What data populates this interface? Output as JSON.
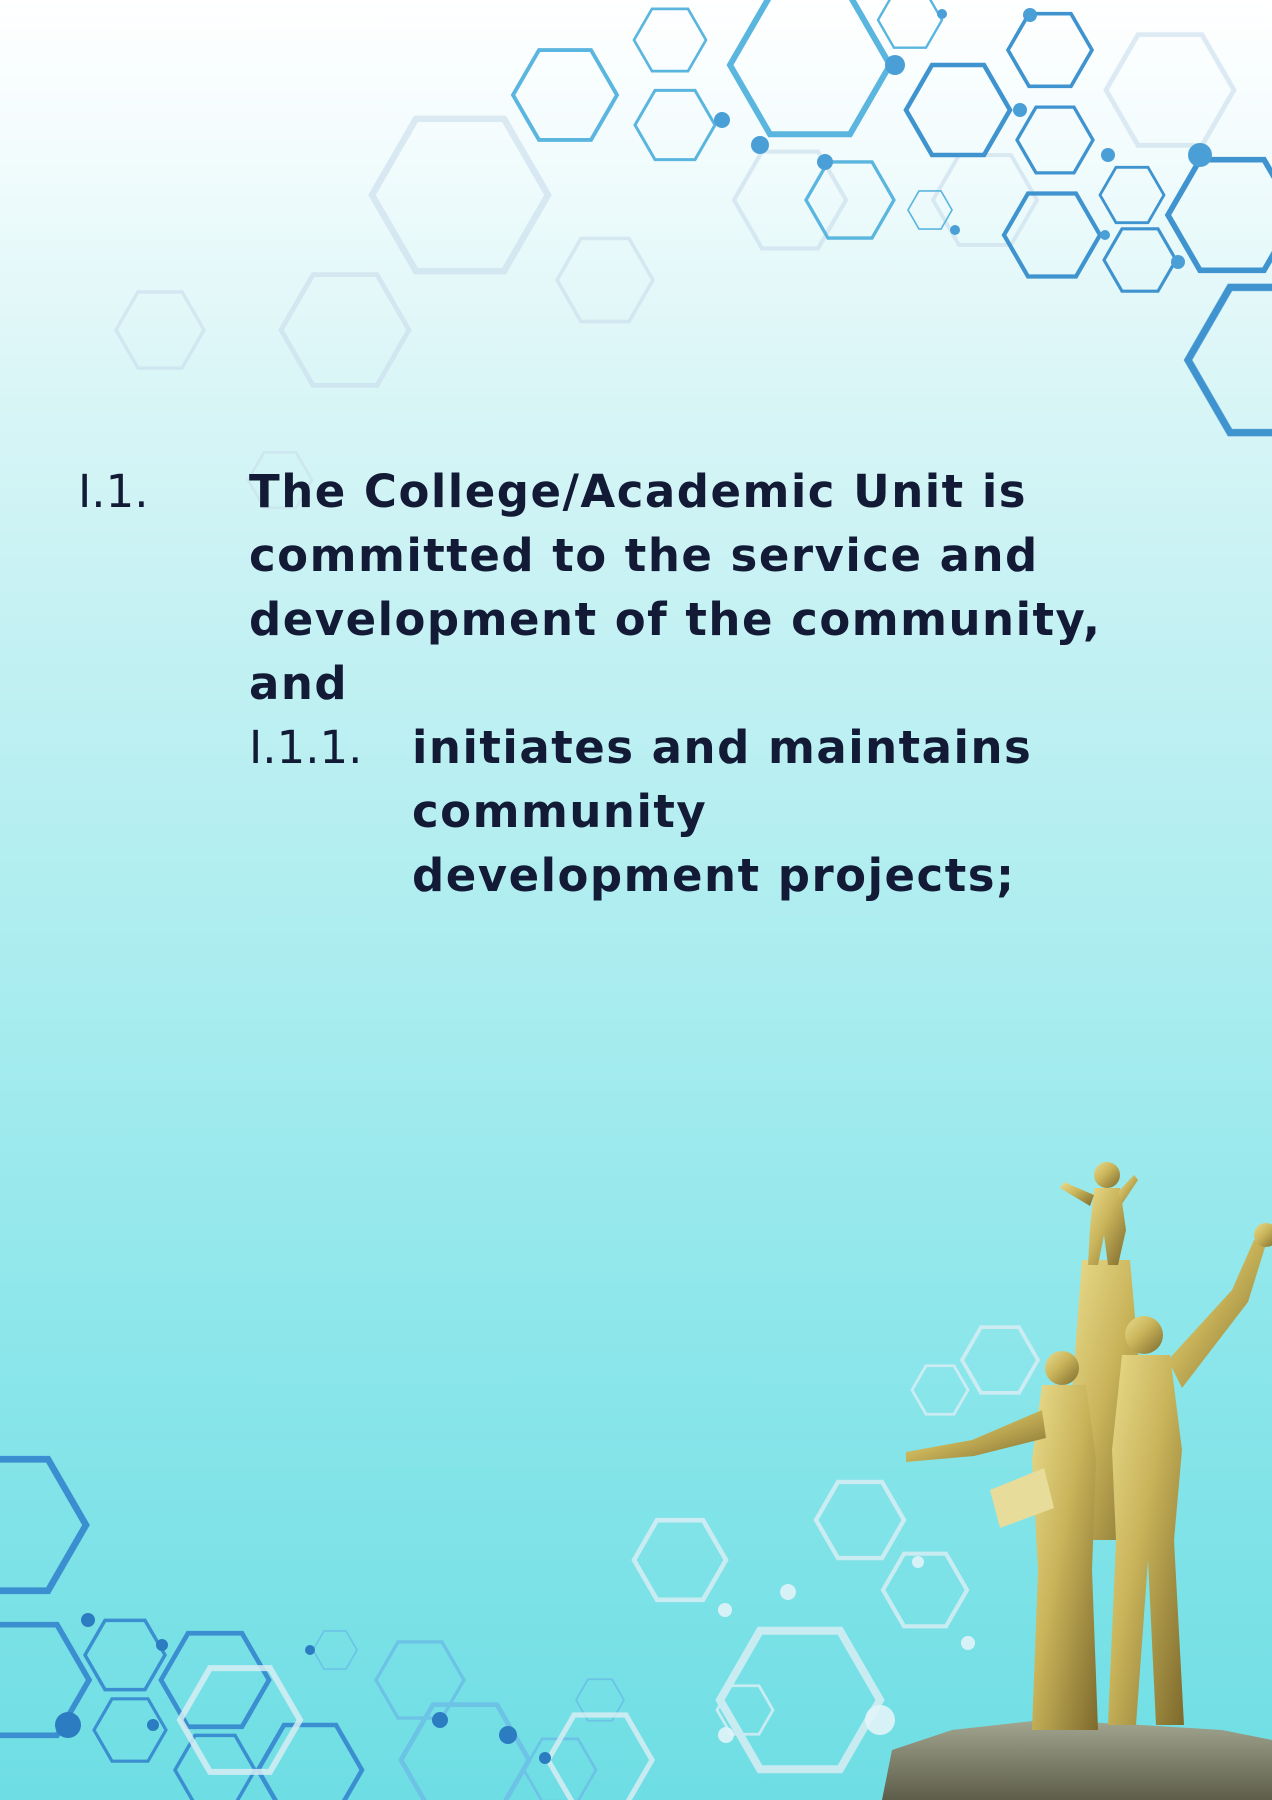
{
  "document": {
    "sections": [
      {
        "number": "I.1.",
        "text": "The College/Academic Unit is committed to the service and development of the community, and"
      },
      {
        "number": "I.1.1.",
        "text": "initiates and maintains community development projects;"
      }
    ]
  },
  "colors": {
    "text": "#121a36",
    "hex_accent": "#3aa6d8",
    "hex_dark": "#2f74b8",
    "background_top": "#ffffff",
    "background_bottom": "#6edee4",
    "statue_gold": "#c9b45a"
  },
  "decorations": {
    "top_right": "hexagon-network-pattern",
    "bottom_left": "hexagon-network-pattern",
    "bottom_right": "golden-statue-monument"
  }
}
